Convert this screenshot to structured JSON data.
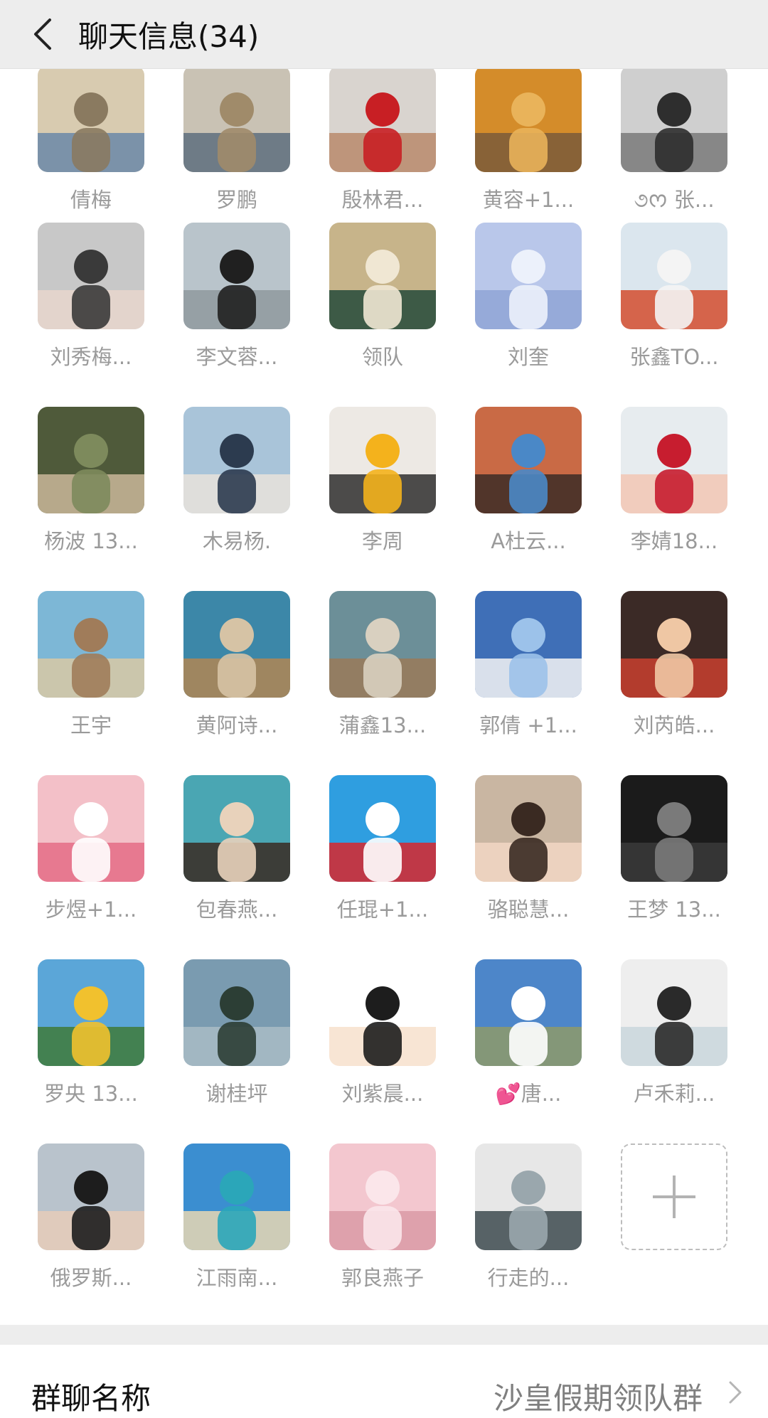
{
  "header": {
    "title": "聊天信息(34)",
    "back_icon": "chevron-left-icon"
  },
  "members": [
    {
      "name": "倩梅",
      "avatar": "photo-canal-city"
    },
    {
      "name": "罗鹏",
      "avatar": "photo-statue"
    },
    {
      "name": "殷林君...",
      "avatar": "photo-red-balloon"
    },
    {
      "name": "黄容+1...",
      "avatar": "photo-autumn-trees"
    },
    {
      "name": "૭ᰔ 张...",
      "avatar": "photo-man-bw"
    },
    {
      "name": "刘秀梅...",
      "avatar": "photo-woman-sunglasses"
    },
    {
      "name": "李文蓉...",
      "avatar": "photo-woman-wall"
    },
    {
      "name": "领队",
      "avatar": "photo-woman-scarf"
    },
    {
      "name": "刘奎",
      "avatar": "photo-snow-sky"
    },
    {
      "name": "张鑫TO...",
      "avatar": "photo-man-basketball"
    },
    {
      "name": "杨波 13...",
      "avatar": "photo-camouflage"
    },
    {
      "name": "木易杨.",
      "avatar": "photo-man-harbor"
    },
    {
      "name": "李周",
      "avatar": "photo-yellow-suit"
    },
    {
      "name": "A杜云...",
      "avatar": "photo-red-wall"
    },
    {
      "name": "李婧18...",
      "avatar": "photo-red-hat"
    },
    {
      "name": "王宇",
      "avatar": "photo-coast-rocks"
    },
    {
      "name": "黄阿诗...",
      "avatar": "photo-beach-hat"
    },
    {
      "name": "蒲鑫13...",
      "avatar": "photo-cat-mountain"
    },
    {
      "name": "郭倩 +1...",
      "avatar": "photo-swans-lake"
    },
    {
      "name": "刘芮皓...",
      "avatar": "photo-baby"
    },
    {
      "name": "步煜+1...",
      "avatar": "photo-white-cat"
    },
    {
      "name": "包春燕...",
      "avatar": "photo-dog-beach"
    },
    {
      "name": "任琨+1...",
      "avatar": "photo-doraemon"
    },
    {
      "name": "骆聪慧...",
      "avatar": "photo-girl-laughing"
    },
    {
      "name": "王梦 13...",
      "avatar": "photo-dragon-sigil"
    },
    {
      "name": "罗央 13...",
      "avatar": "photo-yellow-hut"
    },
    {
      "name": "谢桂坪",
      "avatar": "photo-silhouette-lake"
    },
    {
      "name": "刘紫晨...",
      "avatar": "photo-cartoon-boy"
    },
    {
      "name": "💕唐...",
      "avatar": "photo-sky-clouds"
    },
    {
      "name": "卢禾莉...",
      "avatar": "photo-woman-light"
    },
    {
      "name": "俄罗斯...",
      "avatar": "photo-man-suit"
    },
    {
      "name": "江雨南...",
      "avatar": "photo-beach-boats"
    },
    {
      "name": "郭良燕子",
      "avatar": "photo-pink-dress"
    },
    {
      "name": "行走的...",
      "avatar": "photo-circle-lake"
    }
  ],
  "add_member_icon": "plus-icon",
  "group_name_row": {
    "label": "群聊名称",
    "value": "沙皇假期领队群",
    "chevron_icon": "chevron-right-icon"
  }
}
